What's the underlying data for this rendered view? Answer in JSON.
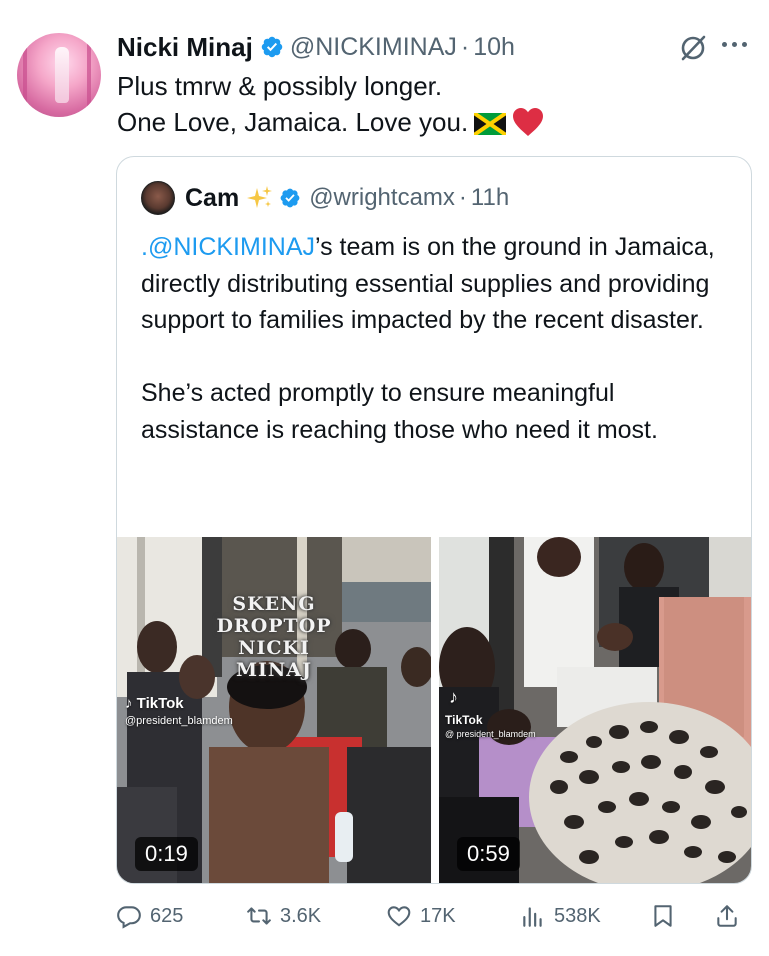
{
  "tweet": {
    "author_name": "Nicki Minaj",
    "handle": "@NICKIMINAJ",
    "separator": "·",
    "time": "10h",
    "line1": "Plus tmrw & possibly longer.",
    "line2": "One Love, Jamaica. Love you."
  },
  "quote": {
    "author_name": "Cam",
    "handle": "@wrightcamx",
    "separator": "·",
    "time": "11h",
    "mention": ".@NICKIMINAJ",
    "text_p1": "’s team is on the ground in Jamaica, directly distributing essential supplies and providing support to families impacted by the recent disaster.",
    "text_p2": "She’s acted promptly to ensure meaningful assistance is reaching those who need it most.",
    "videos": [
      {
        "overlay_text_1": "SKENG",
        "overlay_text_2": "DROPTOP",
        "overlay_text_3": "NICKI MINAJ",
        "tiktok_label": "TikTok",
        "tiktok_user": "@president_blamdem",
        "duration": "0:19"
      },
      {
        "tiktok_label": "TikTok",
        "tiktok_user": "@ president_blamdem",
        "duration": "0:59"
      }
    ]
  },
  "actions": {
    "replies": "625",
    "reposts": "3.6K",
    "likes": "17K",
    "views": "538K"
  },
  "colors": {
    "accent": "#1d9bf0",
    "secondary_text": "#536471",
    "verified": "#1d9bf0",
    "border": "#cfd9de"
  },
  "icons": [
    "verified-badge-icon",
    "grok-icon",
    "more-icon",
    "jamaica-flag-icon",
    "red-heart-icon",
    "sparkles-icon",
    "reply-icon",
    "repost-icon",
    "like-icon",
    "views-icon",
    "bookmark-icon",
    "share-icon",
    "tiktok-icon"
  ]
}
